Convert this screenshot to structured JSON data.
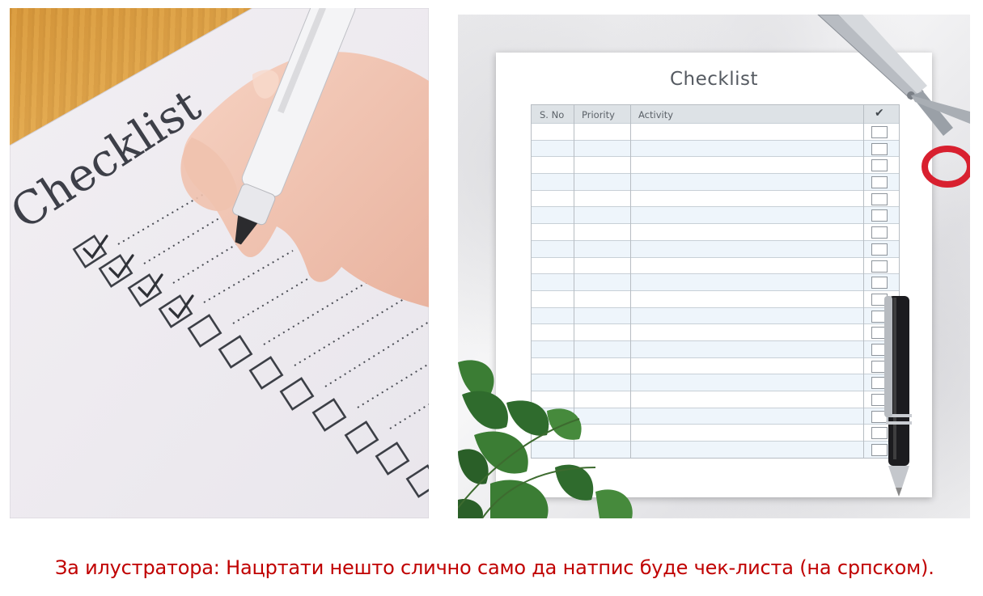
{
  "left_image": {
    "paper_title": "Checklist",
    "marker_label_text": "..."
  },
  "right_image": {
    "sheet_title": "Checklist",
    "columns": [
      "S. No",
      "Priority",
      "Activity"
    ],
    "check_header_icon": "checkmark-icon",
    "row_count": 20,
    "colors": {
      "header_bg": "#dde2e6",
      "row_alt": "#eef5fb",
      "scissors_handle": "#d8202f"
    }
  },
  "caption": "За илустратора: Нацртати нешто слично само да натпис буде чек-листа (на српском)."
}
